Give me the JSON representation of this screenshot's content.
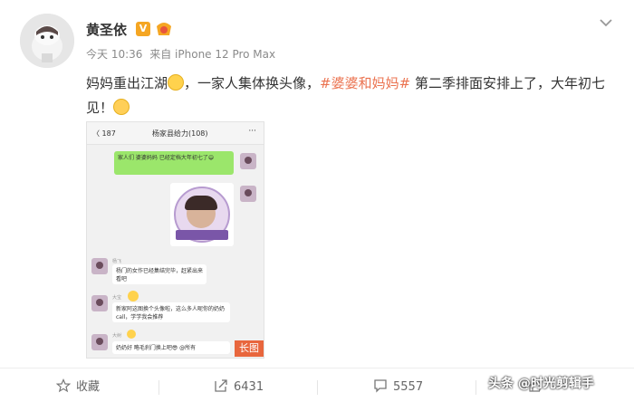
{
  "post": {
    "author": "黄圣依",
    "meta": {
      "time": "今天 10:36",
      "source": "来自 iPhone 12 Pro Max"
    },
    "content": {
      "part1": "妈妈重出江湖",
      "part2": "，一家人集体换头像，",
      "hashtag": "#婆婆和妈妈#",
      "part3": " 第二季排面安排上了，大年初七见！"
    }
  },
  "screenshot": {
    "back": "〈 187",
    "group_title": "杨家县给力(108)",
    "dots": "···",
    "msg1": "家人们 婆婆妈妈 已经定档大年初七了😄",
    "msg2_sender": "杨飞",
    "msg2": "杨门的女作已经集结完毕，赶紧出来看吧",
    "msg3_sender": "大宝",
    "msg3": "新家阿这图换个头像啦，这么多人呢你的奶奶 call，学学我会推荐",
    "msg4_sender": "大树",
    "msg4": "奶奶好 略毛刹门换上吧😎 @所有",
    "long_label": "长图"
  },
  "actions": [
    {
      "label": "收藏",
      "icon": "star-icon"
    },
    {
      "label": "6431",
      "icon": "share-icon"
    },
    {
      "label": "5557",
      "icon": "comment-icon"
    },
    {
      "label": "",
      "icon": "like-icon"
    }
  ],
  "watermark": "头条 @时光剪辑手",
  "colors": {
    "hashtag": "#eb7350",
    "badge": "#f5a623",
    "long_tag": "#e8663d"
  }
}
